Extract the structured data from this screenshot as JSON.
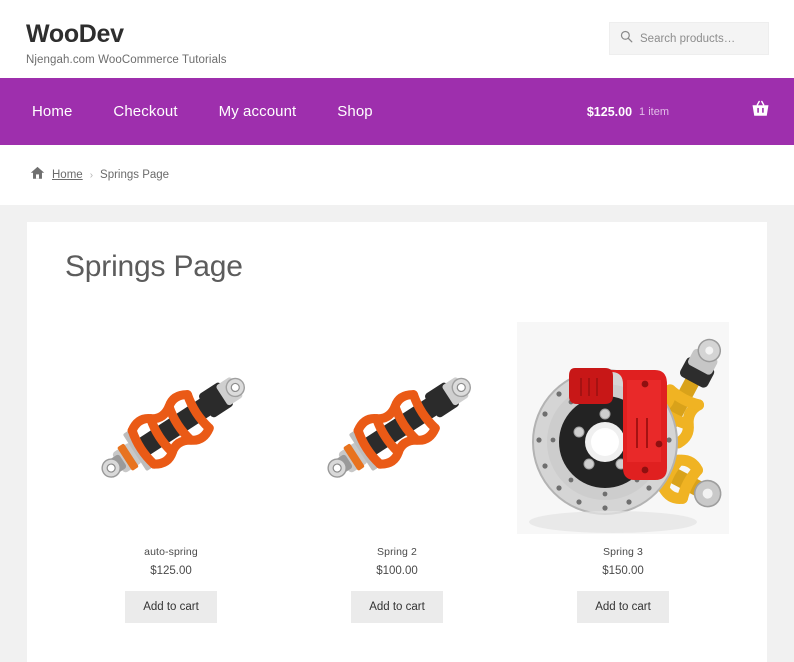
{
  "header": {
    "site_title": "WooDev",
    "tagline": "Njengah.com WooCommerce Tutorials",
    "search": {
      "placeholder": "Search products…",
      "value": "",
      "icon": "search-icon"
    }
  },
  "nav": {
    "items": [
      {
        "label": "Home"
      },
      {
        "label": "Checkout"
      },
      {
        "label": "My account"
      },
      {
        "label": "Shop"
      }
    ],
    "cart": {
      "total": "$125.00",
      "count": "1 item",
      "icon": "shopping-basket-icon"
    },
    "background_color": "#9e2fad"
  },
  "breadcrumb": {
    "home_icon": "home-icon",
    "home_label": "Home",
    "separator": "›",
    "current": "Springs Page"
  },
  "main": {
    "page_title": "Springs Page",
    "products": [
      {
        "title": "auto-spring",
        "price": "$125.00",
        "button_label": "Add to cart",
        "image": "orange-coilover-shock-absorber"
      },
      {
        "title": "Spring 2",
        "price": "$100.00",
        "button_label": "Add to cart",
        "image": "orange-coilover-shock-absorber"
      },
      {
        "title": "Spring 3",
        "price": "$150.00",
        "button_label": "Add to cart",
        "image": "brake-disc-red-caliper-yellow-springs"
      }
    ]
  },
  "colors": {
    "accent": "#9e2fad",
    "page_background": "#f1f1f1",
    "card_background": "#ffffff",
    "button_background": "#ebebeb"
  }
}
